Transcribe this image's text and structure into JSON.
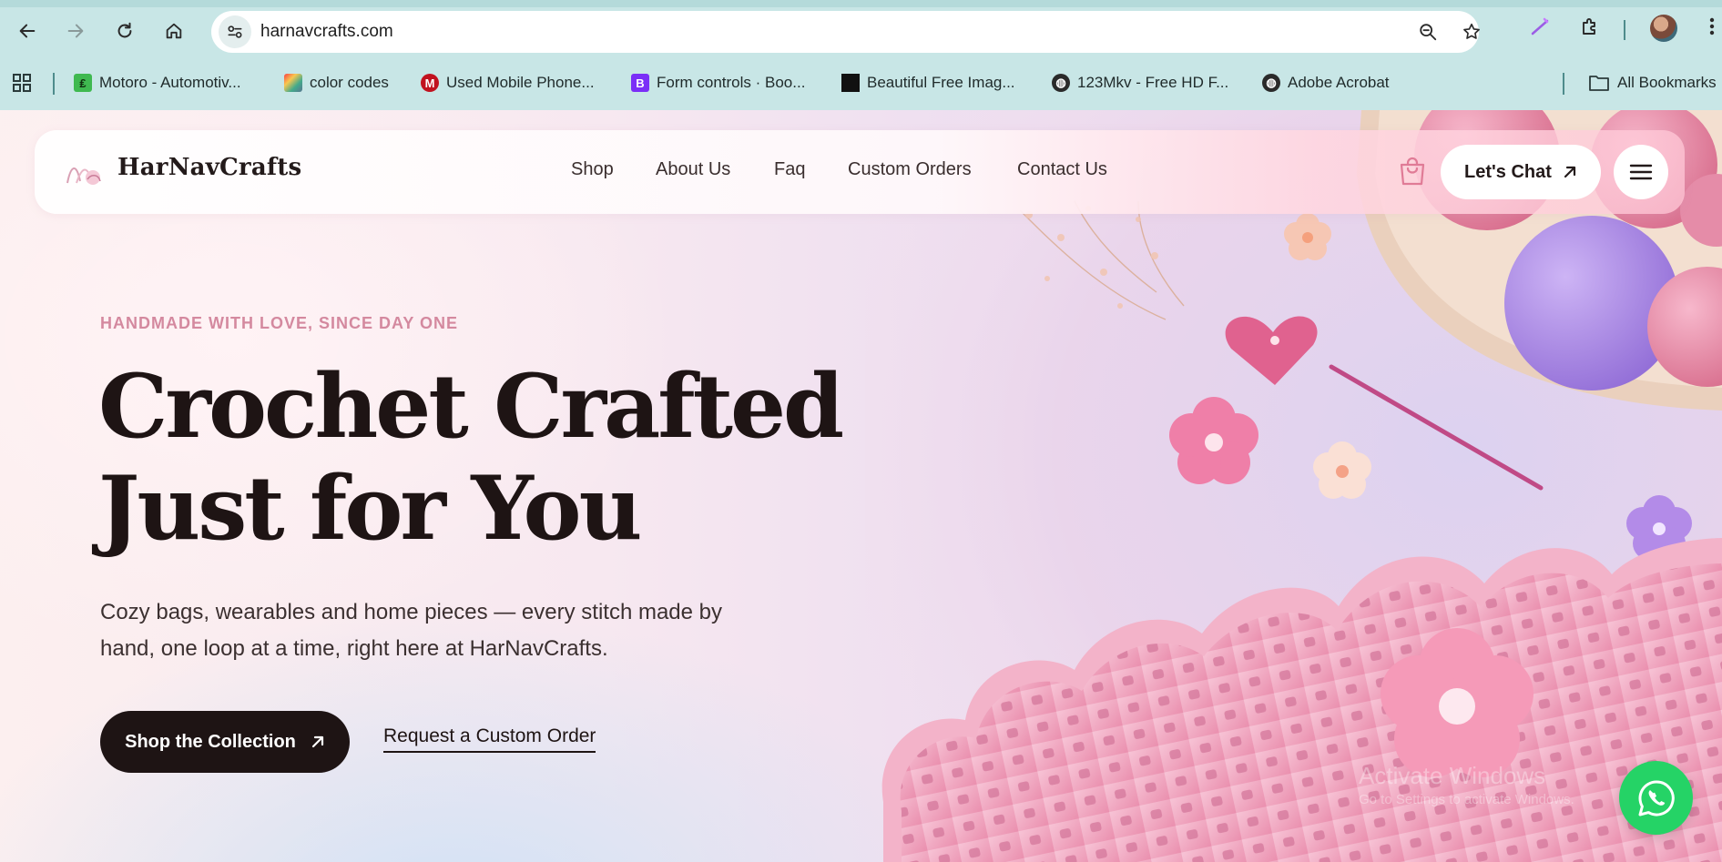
{
  "browser": {
    "url": "harnavcrafts.com",
    "bookmarks": [
      {
        "label": "Motoro - Automotiv...",
        "icon": "motoro-favicon"
      },
      {
        "label": "color codes",
        "icon": "color-codes-favicon"
      },
      {
        "label": "Used Mobile Phone...",
        "icon": "used-mobile-favicon"
      },
      {
        "label": "Form controls · Boo...",
        "icon": "bootstrap-favicon"
      },
      {
        "label": "Beautiful Free Imag...",
        "icon": "unsplash-favicon"
      },
      {
        "label": "123Mkv - Free HD F...",
        "icon": "globe-icon"
      },
      {
        "label": "Adobe Acrobat",
        "icon": "globe-icon"
      }
    ],
    "all_bookmarks_label": "All Bookmarks"
  },
  "site": {
    "brand": "HarNavCrafts",
    "nav": [
      {
        "label": "Shop"
      },
      {
        "label": "About Us"
      },
      {
        "label": "Faq"
      },
      {
        "label": "Custom Orders"
      },
      {
        "label": "Contact Us"
      }
    ],
    "chat_label": "Let's Chat"
  },
  "hero": {
    "eyebrow": "HANDMADE WITH LOVE, SINCE DAY ONE",
    "headline_line1": "Crochet Crafted",
    "headline_line2": "Just for You",
    "subtext": "Cozy bags, wearables and home pieces — every stitch made by hand, one loop at a time, right here at HarNavCrafts.",
    "primary_cta": "Shop the Collection",
    "secondary_cta": "Request a Custom Order"
  },
  "watermark": {
    "line1": "Activate Windows",
    "line2": "Go to Settings to activate Windows."
  },
  "colors": {
    "chrome": "#c8e6e6",
    "accent_dark": "#1e1414",
    "eyebrow": "#d4899f",
    "whatsapp": "#25d366"
  }
}
